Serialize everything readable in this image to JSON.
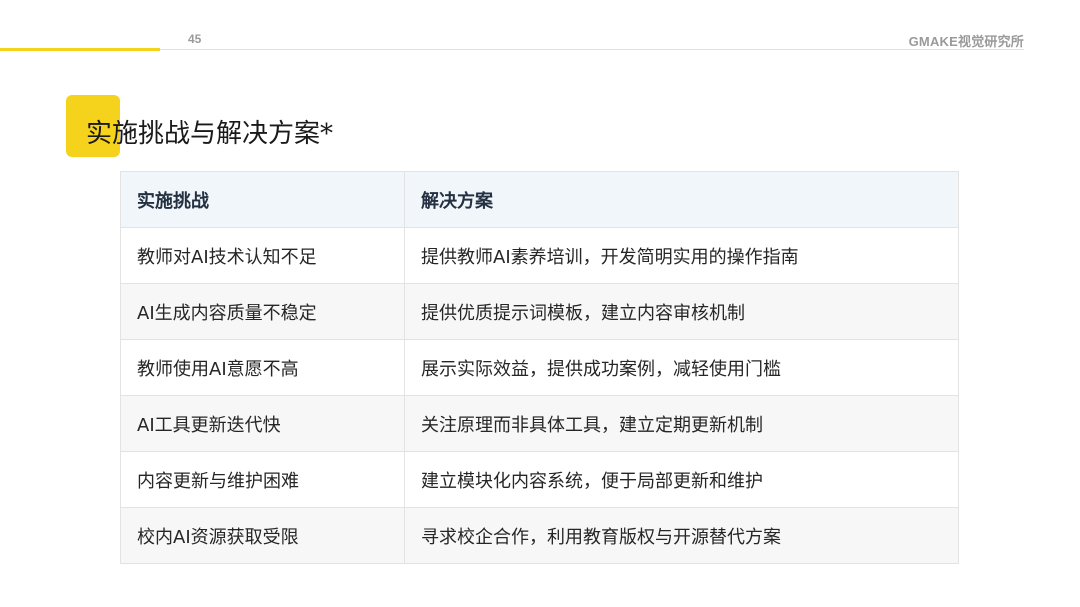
{
  "header": {
    "page_number": "45",
    "brand": "GMAKE视觉研究所",
    "accent_color": "#f5d31c"
  },
  "slide": {
    "title": "实施挑战与解决方案*"
  },
  "table": {
    "headers": [
      "实施挑战",
      "解决方案"
    ],
    "rows": [
      [
        "教师对AI技术认知不足",
        "提供教师AI素养培训，开发简明实用的操作指南"
      ],
      [
        "AI生成内容质量不稳定",
        "提供优质提示词模板，建立内容审核机制"
      ],
      [
        "教师使用AI意愿不高",
        "展示实际效益，提供成功案例，减轻使用门槛"
      ],
      [
        "AI工具更新迭代快",
        "关注原理而非具体工具，建立定期更新机制"
      ],
      [
        "内容更新与维护困难",
        "建立模块化内容系统，便于局部更新和维护"
      ],
      [
        "校内AI资源获取受限",
        "寻求校企合作，利用教育版权与开源替代方案"
      ]
    ]
  }
}
